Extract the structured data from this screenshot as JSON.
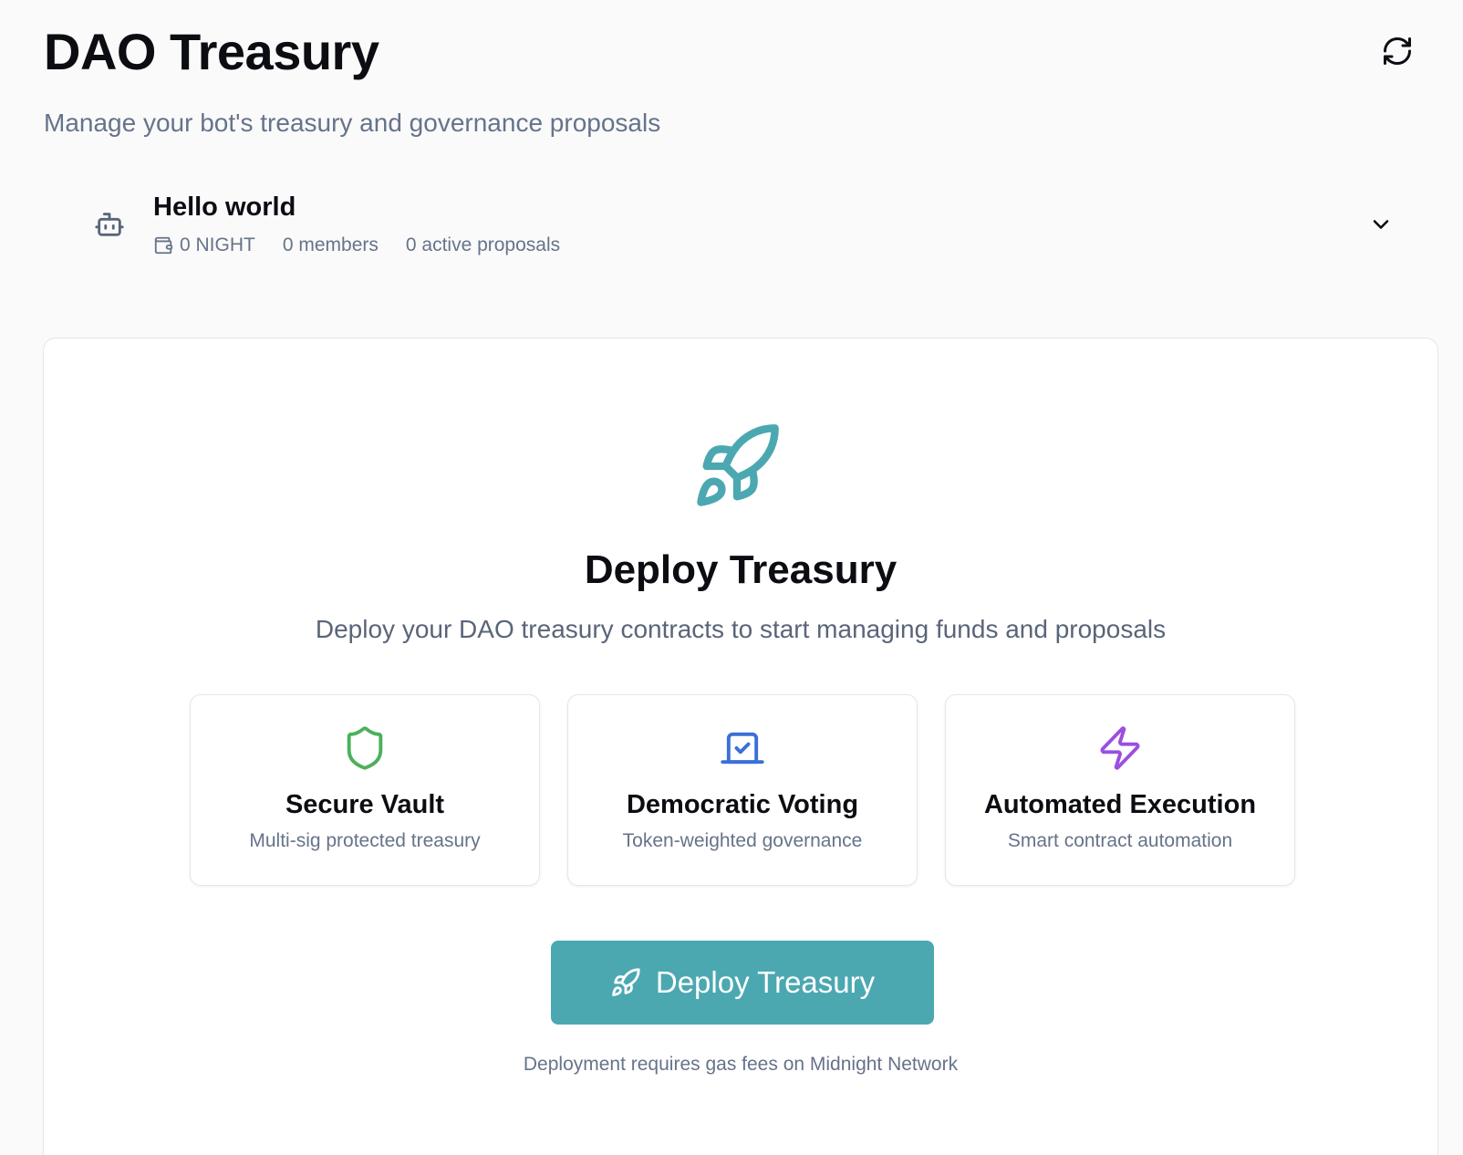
{
  "header": {
    "title": "DAO Treasury",
    "subtitle": "Manage your bot's treasury and governance proposals",
    "refresh_icon": "refresh-icon"
  },
  "bot": {
    "name": "Hello world",
    "balance": "0 NIGHT",
    "members": "0 members",
    "active_proposals": "0 active proposals",
    "icon": "bot-icon"
  },
  "deploy": {
    "title": "Deploy Treasury",
    "description": "Deploy your DAO treasury contracts to start managing funds and proposals",
    "button_label": "Deploy Treasury",
    "note": "Deployment requires gas fees on Midnight Network",
    "accent_color": "#4ba8b1"
  },
  "features": [
    {
      "title": "Secure Vault",
      "description": "Multi-sig protected treasury",
      "icon": "shield-icon",
      "color": "#4cb05c"
    },
    {
      "title": "Democratic Voting",
      "description": "Token-weighted governance",
      "icon": "vote-icon",
      "color": "#3b6fd9"
    },
    {
      "title": "Automated Execution",
      "description": "Smart contract automation",
      "icon": "lightning-icon",
      "color": "#9b4fe0"
    }
  ]
}
